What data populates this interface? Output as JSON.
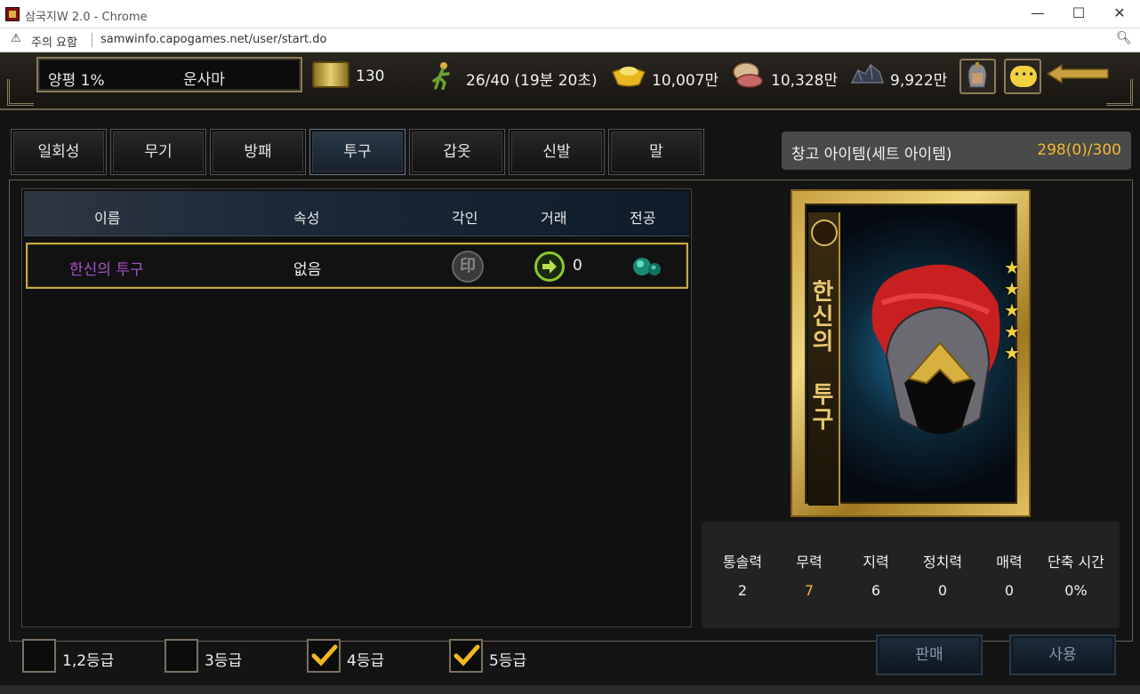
{
  "browser": {
    "title": "삼국지W 2.0 - Chrome",
    "security_label": "주의 요함",
    "url": "samwinfo.capogames.net/user/start.do"
  },
  "header": {
    "rank": "양평 1%",
    "player_name": "운사마",
    "resources": {
      "scroll": "130",
      "stamina": "26/40 (19분 20초)",
      "gold": "10,007만",
      "food": "10,328만",
      "ore": "9,922만"
    }
  },
  "tabs": [
    {
      "label": "일회성"
    },
    {
      "label": "무기"
    },
    {
      "label": "방패"
    },
    {
      "label": "투구",
      "active": true
    },
    {
      "label": "갑옷"
    },
    {
      "label": "신발"
    },
    {
      "label": "말"
    }
  ],
  "warehouse": {
    "label": "창고 아이템(세트 아이템)",
    "count": "298(0)/300"
  },
  "table": {
    "headers": {
      "name": "이름",
      "attr": "속성",
      "engrave": "각인",
      "trade": "거래",
      "transfer": "전공"
    },
    "rows": [
      {
        "name": "한신의 투구",
        "attr": "없음",
        "engrave_icon": "seal-icon",
        "trade_count": "0",
        "transfer_icon": "gem-icon"
      }
    ]
  },
  "card": {
    "title": "한신의 투구",
    "stars": 5,
    "accent": "#c8a040"
  },
  "stats": [
    {
      "label": "통솔력",
      "value": "2"
    },
    {
      "label": "무력",
      "value": "7",
      "highlight": true
    },
    {
      "label": "지력",
      "value": "6"
    },
    {
      "label": "정치력",
      "value": "0"
    },
    {
      "label": "매력",
      "value": "0"
    },
    {
      "label": "단축 시간",
      "value": "0%"
    }
  ],
  "grades": [
    {
      "label": "1,2등급",
      "checked": false
    },
    {
      "label": "3등급",
      "checked": false
    },
    {
      "label": "4등급",
      "checked": true
    },
    {
      "label": "5등급",
      "checked": true
    }
  ],
  "buttons": {
    "sell": "판매",
    "use": "사용"
  }
}
